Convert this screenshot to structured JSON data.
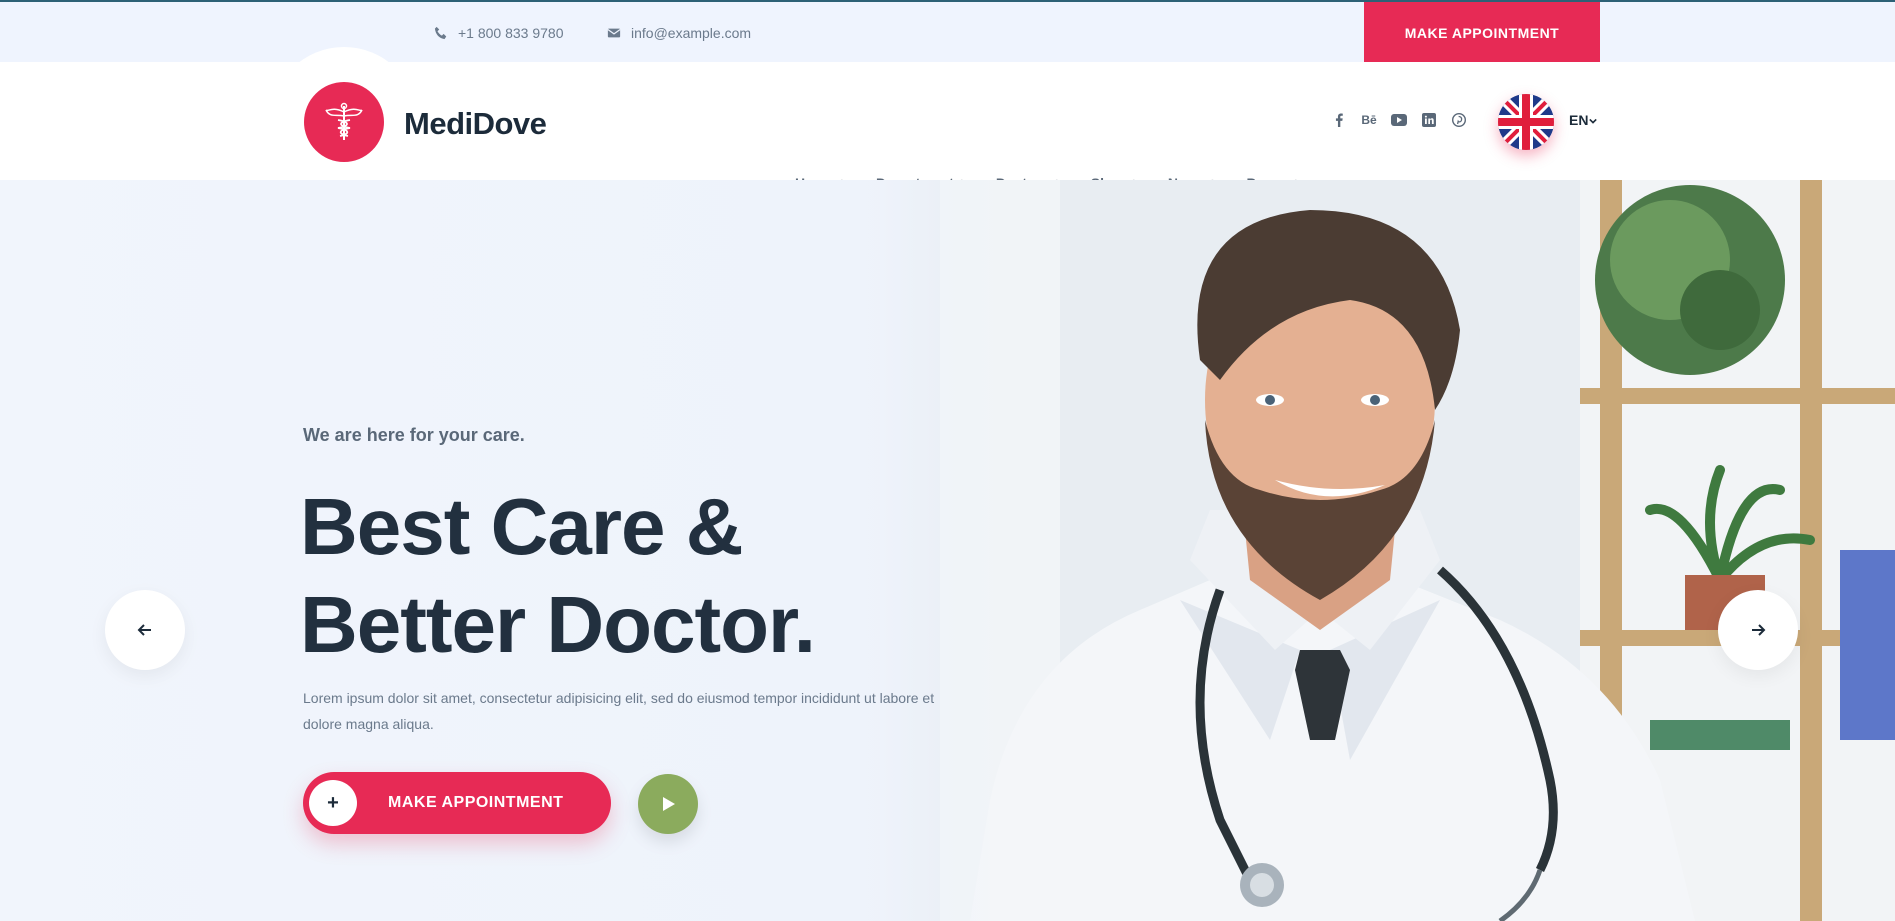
{
  "topbar": {
    "phone": "+1 800 833 9780",
    "email": "info@example.com",
    "cta_label": "MAKE APPOINTMENT"
  },
  "header": {
    "brand": "MediDove",
    "nav": [
      {
        "label": "Home +"
      },
      {
        "label": "Department +"
      },
      {
        "label": "Doctors +"
      },
      {
        "label": "Shop +"
      },
      {
        "label": "News +"
      },
      {
        "label": "Pages +"
      }
    ],
    "social": [
      "facebook-icon",
      "behance-icon",
      "youtube-icon",
      "linkedin-icon",
      "pinterest-icon"
    ],
    "behance_label": "Bē",
    "language": "EN"
  },
  "hero": {
    "tagline": "We are here for your care.",
    "title_line1": "Best Care &",
    "title_line2": "Better Doctor.",
    "description": "Lorem ipsum dolor sit amet, consectetur adipisicing elit, sed do eiusmod tempor incididunt ut labore et dolore magna aliqua.",
    "cta_plus": "+",
    "cta_label": "MAKE APPOINTMENT"
  },
  "colors": {
    "accent": "#e72a55",
    "play": "#8bab5d",
    "heading": "#22303f",
    "topbar_bg": "#eff4fe"
  }
}
